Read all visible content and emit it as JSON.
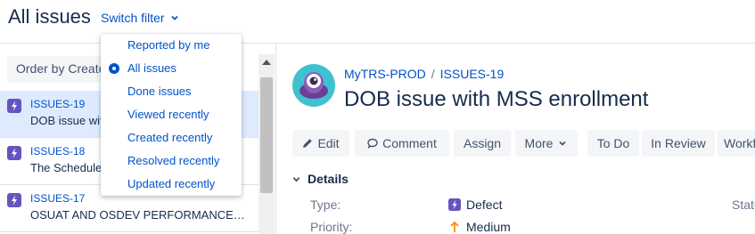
{
  "header": {
    "title": "All issues",
    "switch_filter": "Switch filter"
  },
  "filter_menu": {
    "items": [
      {
        "label": "Reported by me",
        "selected": false
      },
      {
        "label": "All issues",
        "selected": true
      },
      {
        "label": "Done issues",
        "selected": false
      },
      {
        "label": "Viewed recently",
        "selected": false
      },
      {
        "label": "Created recently",
        "selected": false
      },
      {
        "label": "Resolved recently",
        "selected": false
      },
      {
        "label": "Updated recently",
        "selected": false
      }
    ]
  },
  "list": {
    "order_by": "Order by Created",
    "issues": [
      {
        "key": "ISSUES-19",
        "summary": "DOB issue with MSS enrollment",
        "type_icon": "defect-icon",
        "selected": true
      },
      {
        "key": "ISSUES-18",
        "summary": "The Scheduler",
        "type_icon": "defect-icon",
        "selected": false
      },
      {
        "key": "ISSUES-17",
        "summary": "OSUAT AND OSDEV PERFORMANCE…",
        "type_icon": "defect-icon",
        "selected": false
      }
    ]
  },
  "detail": {
    "project": "MyTRS-PROD",
    "issue_key": "ISSUES-19",
    "title": "DOB issue with MSS enrollment",
    "toolbar": {
      "edit": "Edit",
      "comment": "Comment",
      "assign": "Assign",
      "more": "More",
      "todo": "To Do",
      "in_review": "In Review",
      "workflow": "Workflow"
    },
    "details_heading": "Details",
    "type_label": "Type:",
    "type_value": "Defect",
    "priority_label": "Priority:",
    "priority_value": "Medium",
    "status_label": "Status:"
  },
  "colors": {
    "link": "#0052cc",
    "defect": "#6554c0",
    "priority_medium": "#ff8b00",
    "selected_row": "#deebff"
  }
}
